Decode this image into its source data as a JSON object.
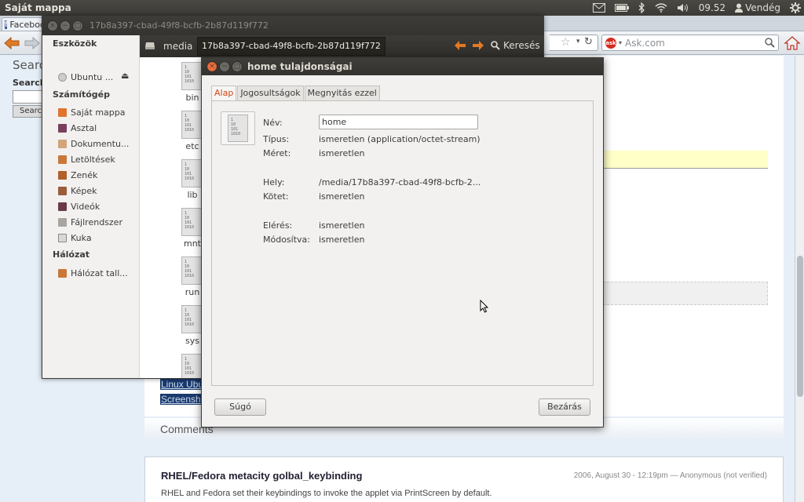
{
  "top_panel": {
    "app_title": "Saját mappa",
    "time": "09.52",
    "user": "Vendég",
    "icons": [
      "mail-icon",
      "battery-icon",
      "bluetooth-icon",
      "wifi-icon",
      "volume-icon",
      "user-icon",
      "power-gear-icon"
    ]
  },
  "browser": {
    "tab_label": "Facebook",
    "search_engine": "Ask.com",
    "page": {
      "search_heading": "Searc",
      "search_label": "Search",
      "search_button": "Searc",
      "link1": "Linux Ubu",
      "link2": "Screensh",
      "comments_heading": "Comments",
      "comment_title": "RHEL/Fedora metacity golbal_keybinding",
      "comment_meta": "2006, August 30 - 12:19pm — Anonymous (not verified)",
      "comment_body": "RHEL and Fedora set their keybindings to invoke the applet via PrintScreen by default."
    }
  },
  "file_manager": {
    "title": "17b8a397-cbad-49f8-bcfb-2b87d119f772",
    "breadcrumb_root": "media",
    "breadcrumb_active": "17b8a397-cbad-49f8-bcfb-2b87d119f772",
    "search_label": "Keresés",
    "sidebar": {
      "devices_header": "Eszközök",
      "device_item": "Ubuntu ...",
      "computer_header": "Számítógép",
      "computer_items": [
        "Saját mappa",
        "Asztal",
        "Dokumentu...",
        "Letöltések",
        "Zenék",
        "Képek",
        "Videók",
        "Fájlrendszer",
        "Kuka"
      ],
      "network_header": "Hálózat",
      "network_item": "Hálózat tall..."
    },
    "files": [
      "bin",
      "etc",
      "lib",
      "mnt",
      "run",
      "sys"
    ]
  },
  "dialog": {
    "title": "home tulajdonságai",
    "tabs": [
      "Alap",
      "Jogosultságok",
      "Megnyitás ezzel"
    ],
    "active_tab": "Alap",
    "labels": {
      "name": "Név:",
      "type": "Típus:",
      "size": "Méret:",
      "location": "Hely:",
      "volume": "Kötet:",
      "accessed": "Elérés:",
      "modified": "Módosítva:"
    },
    "values": {
      "name": "home",
      "type": "ismeretlen (application/octet-stream)",
      "size": "ismeretlen",
      "location": "/media/17b8a397-cbad-49f8-bcfb-2...",
      "volume": "ismeretlen",
      "accessed": "ismeretlen",
      "modified": "ismeretlen"
    },
    "help_button": "Súgó",
    "close_button": "Bezárás"
  },
  "colors": {
    "panel_bg": "#3c3b37",
    "accent_orange": "#dd4814",
    "window_bg": "#f2f1f0"
  }
}
